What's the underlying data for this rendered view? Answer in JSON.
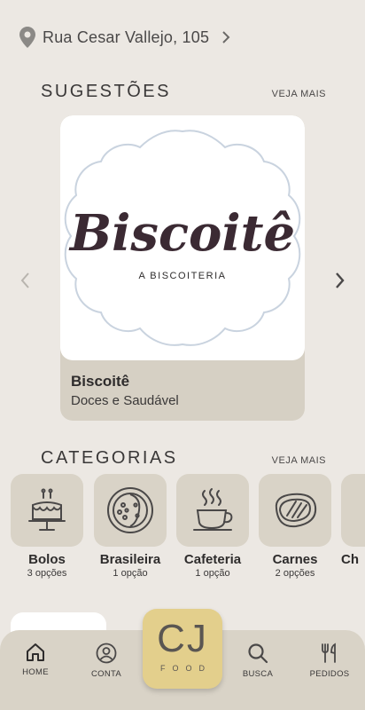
{
  "address": {
    "text": "Rua Cesar Vallejo, 105",
    "icon": "location-pin-icon"
  },
  "suggestions": {
    "title": "SUGESTÕES",
    "see_more": "VEJA MAIS",
    "card": {
      "logo_text": "Biscoitê",
      "logo_subtitle": "A BISCOITERIA",
      "name": "Biscoitê",
      "description": "Doces e Saudável"
    }
  },
  "categories": {
    "title": "CATEGORIAS",
    "see_more": "VEJA MAIS",
    "items": [
      {
        "name": "Bolos",
        "count": "3 opções",
        "icon": "cake-icon"
      },
      {
        "name": "Brasileira",
        "count": "1 opção",
        "icon": "brazilian-dish-icon"
      },
      {
        "name": "Cafeteria",
        "count": "1 opção",
        "icon": "coffee-cup-icon"
      },
      {
        "name": "Carnes",
        "count": "2 opções",
        "icon": "steak-icon"
      },
      {
        "name": "Ch",
        "count": "",
        "icon": "partial-category-icon"
      }
    ]
  },
  "nav": {
    "home": "HOME",
    "account": "CONTA",
    "logo_main": "CJ",
    "logo_sub": "FOOD",
    "search": "BUSCA",
    "orders": "PEDIDOS"
  },
  "colors": {
    "background": "#ece8e3",
    "tile": "#d9d3c7",
    "accent_logo": "#e3cf8c"
  }
}
